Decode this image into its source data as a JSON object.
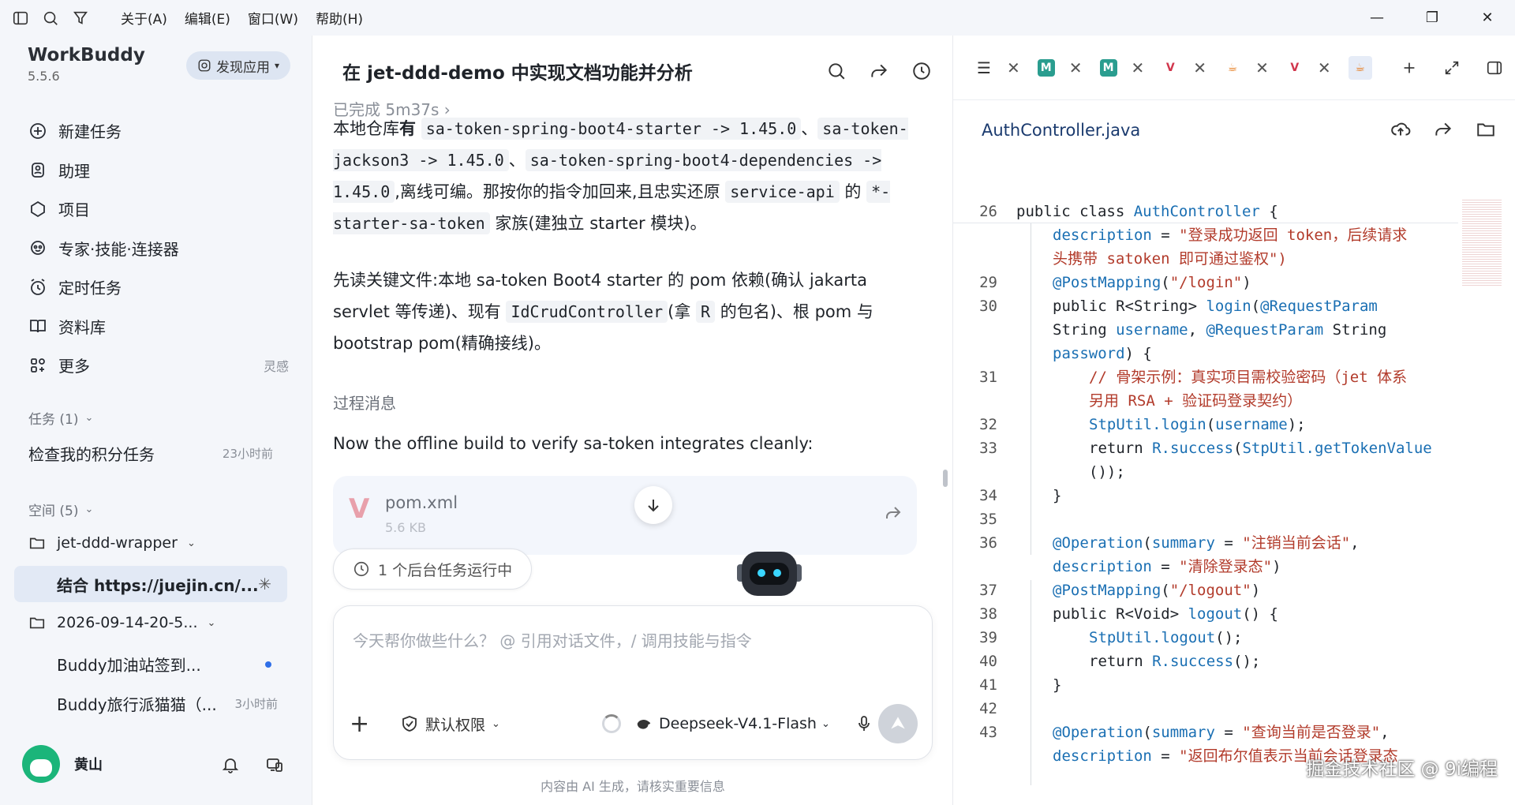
{
  "menu": [
    "关于(A)",
    "编辑(E)",
    "窗口(W)",
    "帮助(H)"
  ],
  "sidebar": {
    "app_name": "WorkBuddy",
    "version": "5.5.6",
    "discover_label": "发现应用",
    "nav": [
      {
        "label": "新建任务",
        "icon": "plus-circle-icon"
      },
      {
        "label": "助理",
        "icon": "assistant-icon"
      },
      {
        "label": "项目",
        "icon": "project-icon"
      },
      {
        "label": "专家·技能·连接器",
        "icon": "expert-icon"
      },
      {
        "label": "定时任务",
        "icon": "alarm-icon"
      },
      {
        "label": "资料库",
        "icon": "book-icon"
      },
      {
        "label": "更多",
        "icon": "grid-icon",
        "extra": "灵感"
      }
    ],
    "tasks_label": "任务 (1)",
    "task": {
      "label": "检查我的积分任务",
      "time": "23小时前"
    },
    "spaces_label": "空间 (5)",
    "folder1": "jet-ddd-wrapper",
    "active_item": "结合 https://juejin.cn/...",
    "folder2": "2026-09-14-20-5...",
    "sub1": "Buddy加油站签到...",
    "sub2": {
      "label": "Buddy旅行派猫猫（...",
      "time": "3小时前"
    },
    "user_name": "黄山"
  },
  "chat": {
    "title": "在 jet-ddd-demo 中实现文档功能并分析",
    "done": "已完成 5m37s",
    "p1": {
      "a": "本地仓库",
      "b": "有",
      "c1": "sa-token-spring-boot4-starter -> 1.45.0",
      "sep1": "、",
      "c2": "sa-token-jackson3 -> 1.45.0",
      "sep2": "、",
      "c3": "sa-token-spring-boot4-dependencies -> 1.45.0",
      "d": ",离线可编。那按你的指令加回来,且忠实还原",
      "c4": "service-api",
      "e": " 的 ",
      "c5": "*-starter-sa-token",
      "f": " 家族(建独立 starter 模块)。"
    },
    "p2": {
      "a": "先读关键文件:本地 sa-token Boot4 starter 的 pom 依赖(确认 jakarta servlet 等传递)、现有 ",
      "c1": "IdCrudController",
      "b": "(拿 ",
      "c2": "R",
      "c": " 的包名)、根 pom 与 bootstrap pom(精确接线)。"
    },
    "process_label": "过程消息",
    "now_text": "Now the offline build to verify sa-token integrates cleanly:",
    "file_name": "pom.xml",
    "file_size": "5.6 KB",
    "bg_task": "1 个后台任务运行中",
    "input_placeholder": "今天帮你做些什么？ @ 引用对话文件，/ 调用技能与指令",
    "permission": "默认权限",
    "model": "Deepseek-V4.1-Flash",
    "disclaimer": "内容由 AI 生成，请核实重要信息"
  },
  "editor": {
    "file_title": "AuthController.java",
    "lines": [
      {
        "n": "26",
        "indent": 0,
        "parts": [
          [
            "kw",
            "public class "
          ],
          [
            "fn",
            "AuthController"
          ],
          [
            "kw",
            " {"
          ]
        ]
      },
      {
        "n": "",
        "indent": 1,
        "parts": [
          [
            "fn",
            "description"
          ],
          [
            "kw",
            " = "
          ],
          [
            "str",
            "\"登录成功返回 token，后续请求"
          ]
        ]
      },
      {
        "n": "",
        "indent": 1,
        "parts": [
          [
            "str",
            "头携带 satoken 即可通过鉴权\")"
          ]
        ]
      },
      {
        "n": "29",
        "indent": 1,
        "parts": [
          [
            "fn",
            "@PostMapping"
          ],
          [
            "kw",
            "("
          ],
          [
            "str",
            "\"/login\""
          ],
          [
            "kw",
            ")"
          ]
        ]
      },
      {
        "n": "30",
        "indent": 1,
        "parts": [
          [
            "kw",
            "public R<String> "
          ],
          [
            "fn",
            "login"
          ],
          [
            "kw",
            "("
          ],
          [
            "fn",
            "@RequestParam"
          ]
        ]
      },
      {
        "n": "",
        "indent": 1,
        "parts": [
          [
            "kw",
            "String "
          ],
          [
            "fn",
            "username"
          ],
          [
            "kw",
            ", "
          ],
          [
            "fn",
            "@RequestParam"
          ],
          [
            "kw",
            " String"
          ]
        ]
      },
      {
        "n": "",
        "indent": 1,
        "parts": [
          [
            "fn",
            "password"
          ],
          [
            "kw",
            ") {"
          ]
        ]
      },
      {
        "n": "31",
        "indent": 2,
        "parts": [
          [
            "cm",
            "// 骨架示例：真实项目需校验密码（jet 体系"
          ]
        ]
      },
      {
        "n": "",
        "indent": 2,
        "parts": [
          [
            "cm",
            "另用 RSA + 验证码登录契约）"
          ]
        ]
      },
      {
        "n": "32",
        "indent": 2,
        "parts": [
          [
            "fn",
            "StpUtil.login"
          ],
          [
            "kw",
            "("
          ],
          [
            "fn",
            "username"
          ],
          [
            "kw",
            ");"
          ]
        ]
      },
      {
        "n": "33",
        "indent": 2,
        "parts": [
          [
            "kw",
            "return "
          ],
          [
            "fn",
            "R.success"
          ],
          [
            "kw",
            "("
          ],
          [
            "fn",
            "StpUtil.getTokenValue"
          ]
        ]
      },
      {
        "n": "",
        "indent": 2,
        "parts": [
          [
            "kw",
            "());"
          ]
        ]
      },
      {
        "n": "34",
        "indent": 1,
        "parts": [
          [
            "kw",
            "}"
          ]
        ]
      },
      {
        "n": "35",
        "indent": 1,
        "parts": []
      },
      {
        "n": "36",
        "indent": 1,
        "parts": [
          [
            "fn",
            "@Operation"
          ],
          [
            "kw",
            "("
          ],
          [
            "fn",
            "summary"
          ],
          [
            "kw",
            " = "
          ],
          [
            "str",
            "\"注销当前会话\""
          ],
          [
            "kw",
            ","
          ]
        ]
      },
      {
        "n": "",
        "indent": 1,
        "parts": [
          [
            "fn",
            "description"
          ],
          [
            "kw",
            " = "
          ],
          [
            "str",
            "\"清除登录态\""
          ],
          [
            "kw",
            ")"
          ]
        ]
      },
      {
        "n": "37",
        "indent": 1,
        "parts": [
          [
            "fn",
            "@PostMapping"
          ],
          [
            "kw",
            "("
          ],
          [
            "str",
            "\"/logout\""
          ],
          [
            "kw",
            ")"
          ]
        ]
      },
      {
        "n": "38",
        "indent": 1,
        "parts": [
          [
            "kw",
            "public R<Void> "
          ],
          [
            "fn",
            "logout"
          ],
          [
            "kw",
            "() {"
          ]
        ]
      },
      {
        "n": "39",
        "indent": 2,
        "parts": [
          [
            "fn",
            "StpUtil.logout"
          ],
          [
            "kw",
            "();"
          ]
        ]
      },
      {
        "n": "40",
        "indent": 2,
        "parts": [
          [
            "kw",
            "return "
          ],
          [
            "fn",
            "R.success"
          ],
          [
            "kw",
            "();"
          ]
        ]
      },
      {
        "n": "41",
        "indent": 1,
        "parts": [
          [
            "kw",
            "}"
          ]
        ]
      },
      {
        "n": "42",
        "indent": 1,
        "parts": []
      },
      {
        "n": "43",
        "indent": 1,
        "parts": [
          [
            "fn",
            "@Operation"
          ],
          [
            "kw",
            "("
          ],
          [
            "fn",
            "summary"
          ],
          [
            "kw",
            " = "
          ],
          [
            "str",
            "\"查询当前是否登录\""
          ],
          [
            "kw",
            ","
          ]
        ]
      },
      {
        "n": "",
        "indent": 1,
        "parts": [
          [
            "fn",
            "description"
          ],
          [
            "kw",
            " = "
          ],
          [
            "str",
            "\"返回布尔值表示当前会话登录态"
          ]
        ]
      }
    ]
  },
  "watermark": "掘金技术社区 @ 9i编程"
}
